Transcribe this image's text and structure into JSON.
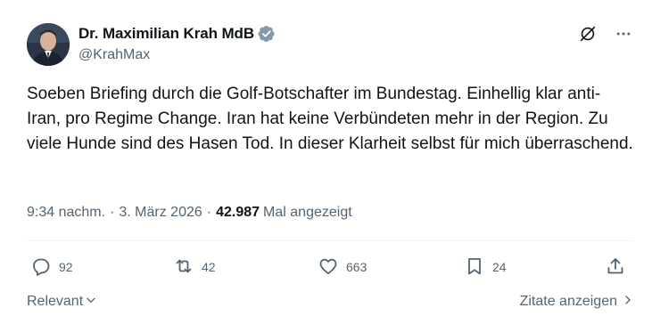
{
  "author": {
    "display_name": "Dr. Maximilian Krah MdB",
    "handle": "@KrahMax",
    "verified": true
  },
  "post": {
    "text": "Soeben Briefing durch die Golf-Botschafter im Bundestag. Einhellig klar anti-Iran, pro Regime Change. Iran hat keine Verbündeten mehr in der Region. Zu viele Hunde sind des Hasen Tod. In dieser Klarheit selbst für mich überraschend."
  },
  "meta": {
    "time": "9:34 nachm.",
    "separator": "·",
    "date": "3. März 2026",
    "views_count": "42.987",
    "views_label": "Mal angezeigt"
  },
  "actions": {
    "replies": "92",
    "reposts": "42",
    "likes": "663",
    "bookmarks": "24"
  },
  "footer": {
    "sort_label": "Relevant",
    "quotes_label": "Zitate anzeigen"
  },
  "icons": [
    "verified-badge-icon",
    "grok-icon",
    "more-icon",
    "reply-icon",
    "repost-icon",
    "like-icon",
    "bookmark-icon",
    "share-icon",
    "chevron-down-icon",
    "chevron-right-icon"
  ],
  "colors": {
    "text_primary": "#0f1419",
    "text_secondary": "#536471",
    "divider": "#eff3f4",
    "verified_badge": "#829aab"
  }
}
